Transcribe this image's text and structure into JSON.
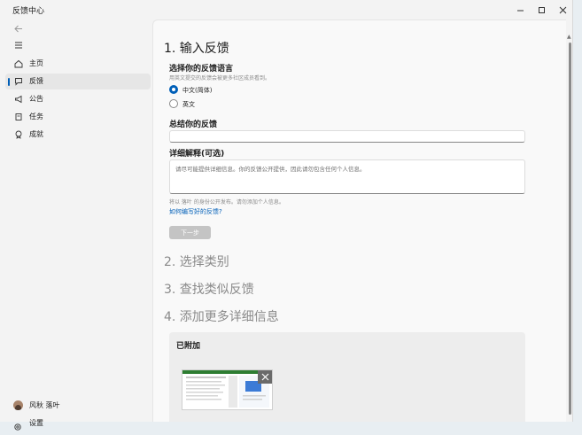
{
  "window": {
    "title": "反馈中心"
  },
  "sidebar": {
    "items": [
      {
        "label": "主页",
        "icon": "home-icon"
      },
      {
        "label": "反馈",
        "icon": "feedback-icon",
        "active": true
      },
      {
        "label": "公告",
        "icon": "megaphone-icon"
      },
      {
        "label": "任务",
        "icon": "quest-icon"
      },
      {
        "label": "成就",
        "icon": "badge-icon"
      }
    ],
    "user_name": "风秋 落叶",
    "settings_label": "设置"
  },
  "form": {
    "step1_title": "1. 输入反馈",
    "language_heading": "选择你的反馈语言",
    "language_hint": "用英文提交的反馈会被更多社区成员看到。",
    "language_options": [
      {
        "label": "中文(简体)",
        "checked": true
      },
      {
        "label": "英文",
        "checked": false
      }
    ],
    "summary_heading": "总结你的反馈",
    "summary_value": "",
    "details_heading": "详细解释(可选)",
    "details_placeholder": "请尽可能提供详细信息。你的反馈公开提供，因此请勿包含任何个人信息。",
    "public_hint": "将以 落叶 的身份公开发布。请勿添加个人信息。",
    "howto_link": "如何编写好的反馈?",
    "next_button": "下一步",
    "step2_title": "2. 选择类别",
    "step3_title": "3. 查找类似反馈",
    "step4_title": "4. 添加更多详细信息",
    "attached_title": "已附加"
  },
  "colors": {
    "accent": "#005fb8",
    "disabled_button": "#c4c4c4"
  }
}
